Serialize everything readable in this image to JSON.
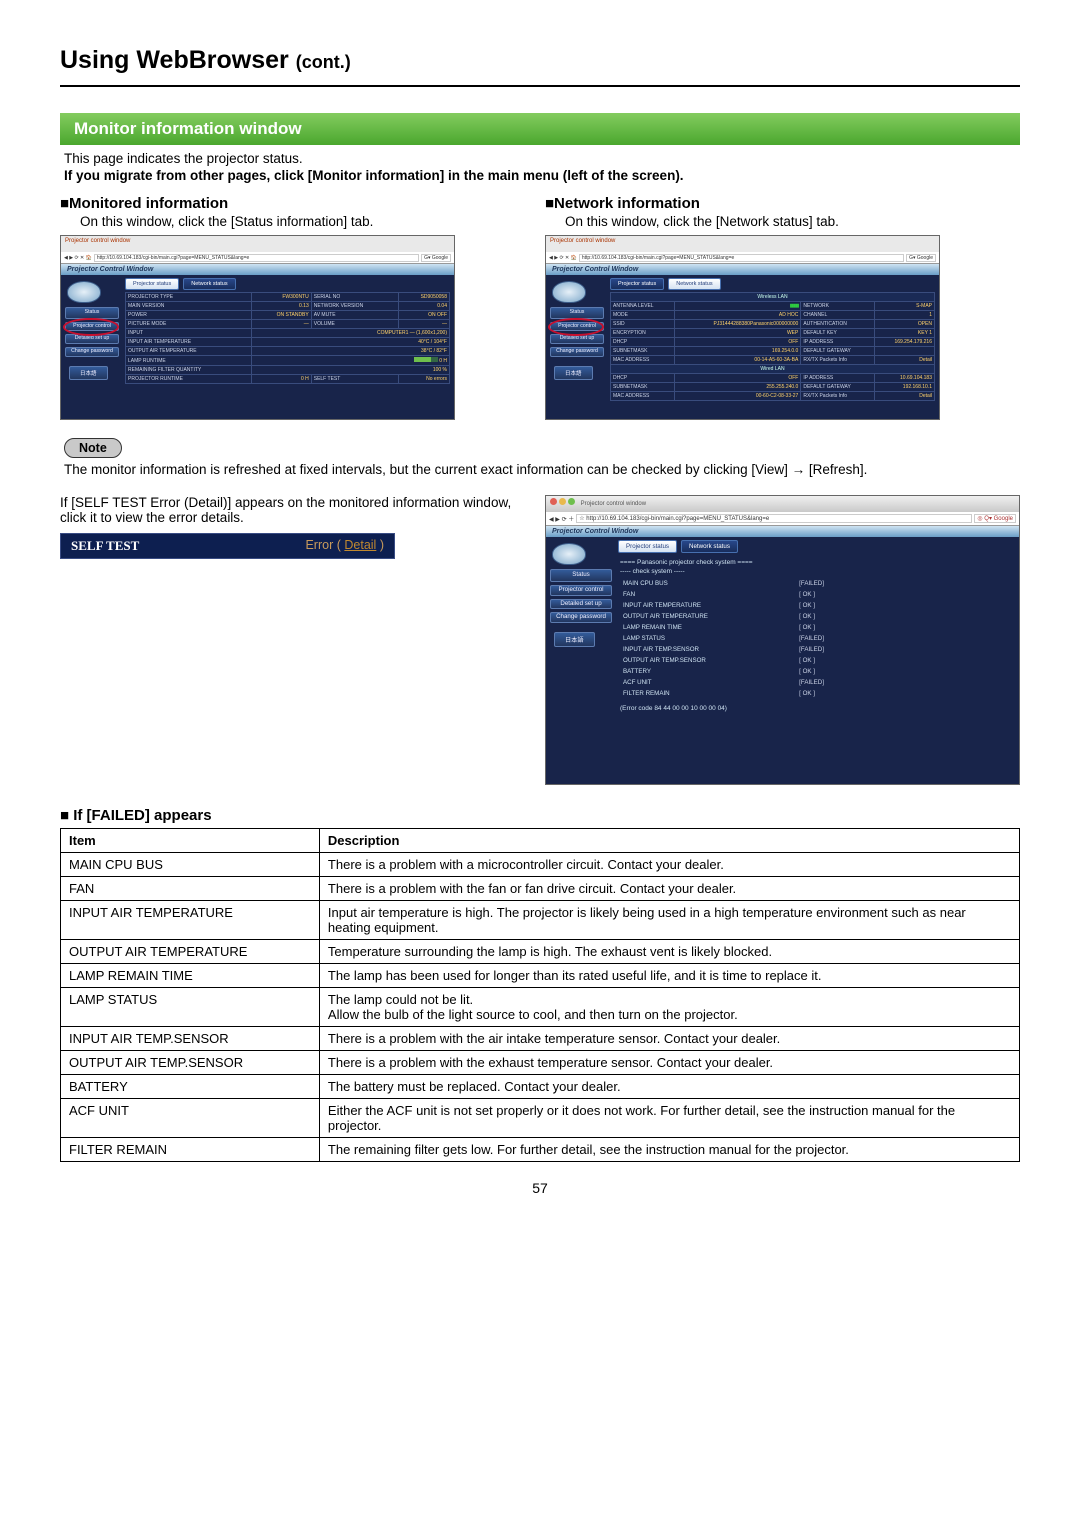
{
  "header": {
    "title": "Using WebBrowser",
    "cont": "(cont.)"
  },
  "section": {
    "title": "Monitor information window"
  },
  "intro": {
    "line1": "This page indicates the projector status.",
    "line2": "If you migrate from other pages, click [Monitor information] in the main menu (left of the screen)."
  },
  "monitored": {
    "heading": "■Monitored information",
    "desc": "On this window, click the [Status information] tab.",
    "topbar_title": "Projector control window",
    "addr": "http://10.69.104.183/cgi-bin/main.cgi?page=MENU_STATUS&lang=e",
    "pcw": "Projector Control Window",
    "tabs": {
      "a": "Projector status",
      "b": "Network status"
    },
    "side": {
      "status": "Status",
      "proj": "Projector control",
      "det": "Detailed set up",
      "chg": "Change password",
      "lang": "日本語"
    },
    "rows": [
      [
        "PROJECTOR TYPE",
        "FW300NTU",
        "SERIAL NO",
        "SD9050058"
      ],
      [
        "MAIN VERSION",
        "0.13",
        "NETWORK VERSION",
        "0.04"
      ],
      [
        "POWER",
        "ON   STANDBY",
        "AV MUTE",
        "ON   OFF"
      ],
      [
        "PICTURE MODE",
        "―",
        "VOLUME",
        "―"
      ],
      [
        "INPUT",
        "COMPUTER1 — (1,600x1,200)",
        "",
        ""
      ],
      [
        "INPUT AIR TEMPERATURE",
        "40°C / 104°F",
        "",
        ""
      ],
      [
        "OUTPUT AIR TEMPERATURE",
        "38°C / 82°F",
        "",
        ""
      ],
      [
        "LAMP RUNTIME",
        "0 H",
        "",
        ""
      ],
      [
        "REMAINING FILTER   QUANTITY",
        "100 %",
        "",
        ""
      ],
      [
        "PROJECTOR RUNTIME",
        "0 H",
        "SELF TEST",
        "No errors"
      ]
    ]
  },
  "network": {
    "heading": "■Network information",
    "desc": "On this window, click the [Network status] tab.",
    "sect_wlan": "Wireless LAN",
    "sect_lan": "Wired LAN",
    "rows_w": [
      [
        "ANTENNA LEVEL",
        "▮▮▮▮▮",
        "NETWORK",
        "S-MAP"
      ],
      [
        "MODE",
        "AD HOC",
        "CHANNEL",
        "1"
      ],
      [
        "SSID",
        "PJ31444288380Panasonic000000000",
        "AUTHENTICATION",
        "OPEN"
      ],
      [
        "ENCRYPTION",
        "WEP",
        "DEFAULT KEY",
        "KEY 1"
      ],
      [
        "DHCP",
        "OFF",
        "IP ADDRESS",
        "169.254.179.216"
      ],
      [
        "SUBNETMASK",
        "169.254.0.0",
        "DEFAULT GATEWAY",
        ""
      ],
      [
        "MAC ADDRESS",
        "00-14-A5-60-3A-BA",
        "RX/TX Packets Info",
        "Detail"
      ]
    ],
    "rows_l": [
      [
        "DHCP",
        "OFF",
        "IP ADDRESS",
        "10.69.104.183"
      ],
      [
        "SUBNETMASK",
        "255.255.240.0",
        "DEFAULT GATEWAY",
        "192.168.10.1"
      ],
      [
        "MAC ADDRESS",
        "00-60-C2-08-33-27",
        "RX/TX Packets Info",
        "Detail"
      ]
    ]
  },
  "note": {
    "label": "Note",
    "text": "The monitor information is refreshed at fixed intervals, but the current exact information can be checked by clicking [View] → [Refresh]."
  },
  "selftest": {
    "para": "If [SELF TEST Error (Detail)] appears on the monitored information window, click it to view the error details.",
    "bar_label": "SELF TEST",
    "bar_err": "Error (",
    "bar_detail": "Detail",
    "bar_close": ")",
    "check_hdr": "==== Panasonic projector check system ====",
    "check_sub": "----- check system -----",
    "results": [
      [
        "MAIN CPU BUS",
        "[FAILED]",
        "fail"
      ],
      [
        "FAN",
        "[ OK ]",
        "ok"
      ],
      [
        "INPUT AIR TEMPERATURE",
        "[ OK ]",
        "ok"
      ],
      [
        "OUTPUT AIR TEMPERATURE",
        "[ OK ]",
        "ok"
      ],
      [
        "LAMP REMAIN TIME",
        "[ OK ]",
        "ok"
      ],
      [
        "LAMP STATUS",
        "[FAILED]",
        "fail"
      ],
      [
        "INPUT AIR TEMP.SENSOR",
        "[FAILED]",
        "fail"
      ],
      [
        "OUTPUT AIR TEMP.SENSOR",
        "[ OK ]",
        "ok"
      ],
      [
        "BATTERY",
        "[ OK ]",
        "ok"
      ],
      [
        "ACF UNIT",
        "[FAILED]",
        "fail"
      ],
      [
        "FILTER REMAIN",
        "[ OK ]",
        "ok"
      ]
    ],
    "errcode": "(Error code 84 44 00 00 10 00 00 04)"
  },
  "failed": {
    "heading": "■ If [FAILED] appears",
    "hdr_item": "Item",
    "hdr_desc": "Description",
    "rows": [
      [
        "MAIN CPU BUS",
        "There is a problem with a microcontroller circuit. Contact your dealer."
      ],
      [
        "FAN",
        "There is a problem with the fan or fan drive circuit. Contact your dealer."
      ],
      [
        "INPUT AIR TEMPERATURE",
        "Input air temperature is high. The projector is likely being used in a high temperature environment such as near heating equipment."
      ],
      [
        "OUTPUT AIR TEMPERATURE",
        "Temperature surrounding the lamp is high. The exhaust vent is likely blocked."
      ],
      [
        "LAMP REMAIN TIME",
        "The lamp has been used for longer than its rated useful life, and it is time to replace it."
      ],
      [
        "LAMP STATUS",
        "The lamp could not be lit.\nAllow the bulb of the light source to cool, and then turn on the projector."
      ],
      [
        "INPUT AIR TEMP.SENSOR",
        "There is a problem with the air intake temperature sensor. Contact your dealer."
      ],
      [
        "OUTPUT AIR TEMP.SENSOR",
        "There is a problem with the exhaust temperature sensor. Contact your dealer."
      ],
      [
        "BATTERY",
        "The battery must be replaced. Contact your dealer."
      ],
      [
        "ACF UNIT",
        "Either the ACF unit is not set properly or it does not work. For further detail, see the instruction manual for the projector."
      ],
      [
        "FILTER REMAIN",
        "The remaining filter gets low. For further detail, see the instruction manual for the projector."
      ]
    ]
  },
  "page_number": "57"
}
